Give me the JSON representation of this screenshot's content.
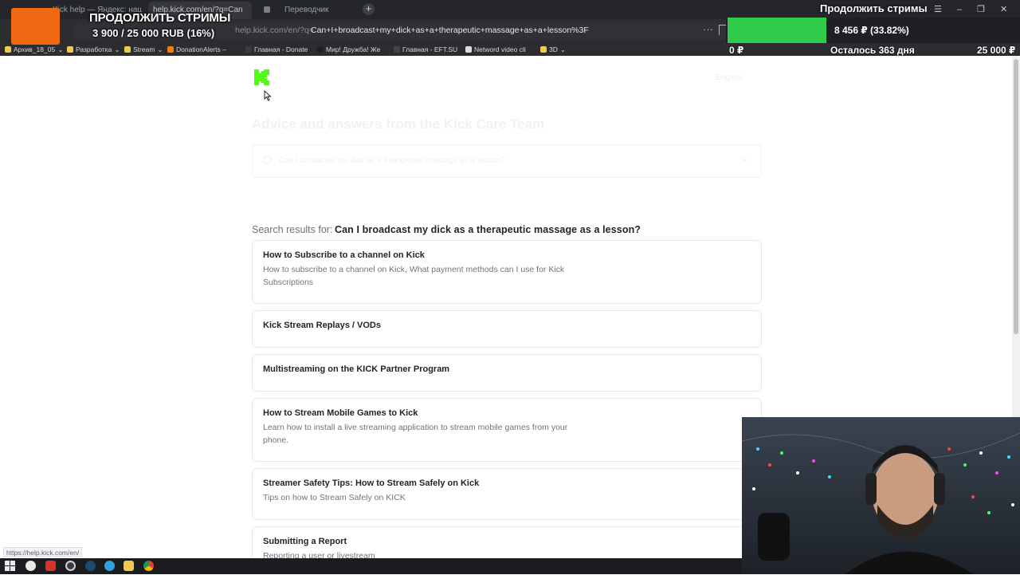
{
  "browser": {
    "tabs": [
      {
        "label": "Kick help — Яндекс: нашлось"
      },
      {
        "label": "help.kick.com/en/?q=Can"
      },
      {
        "label": "Переводчик"
      }
    ],
    "url_host": "help.kick.com/en/?q=",
    "url_query": "Can+I+broadcast+my+dick+as+a+therapeutic+massage+as+a+lesson%3F",
    "url_more": "···",
    "new_tab": "+",
    "window_controls": "☰ – ❐ ✕",
    "bookmarks": [
      {
        "label": "Архив_18_05",
        "icon_color": "#f2c94c",
        "chevron": "⌄"
      },
      {
        "label": "Разработка",
        "icon_color": "#f2c94c",
        "chevron": "⌄"
      },
      {
        "label": "Stream",
        "icon_color": "#f2c94c",
        "chevron": "⌄"
      },
      {
        "label": "DonationAlerts –",
        "icon_color": "#f57d07"
      },
      {
        "label": "Главная - Donate",
        "icon_color": "#3b3b3b"
      },
      {
        "label": "Мир! Дружба! Же",
        "icon_color": "#222222"
      },
      {
        "label": "Главная - EFT.SU",
        "icon_color": "#444444"
      },
      {
        "label": "Netword video cli",
        "icon_color": "#dddddd"
      },
      {
        "label": "3D",
        "icon_color": "#f2c94c",
        "chevron": "⌄"
      }
    ],
    "status_url": "https://help.kick.com/en/"
  },
  "overlay": {
    "left_title": "ПРОДОЛЖИТЬ СТРИМЫ",
    "left_amount": "3 900 / 25 000 RUB (16%)",
    "left_progress_fraction": 0.16,
    "right_title": "Продолжить стримы",
    "goal_amount": "8 456 ₽ (33.82%)",
    "goal_progress_fraction": 0.3382,
    "goal_min": "0 ₽",
    "goal_remaining": "Осталось 363 дня",
    "goal_max": "25 000 ₽",
    "colors": {
      "left_square": "#ef6a12",
      "goal_fill": "#2ecc4a"
    }
  },
  "page": {
    "brand_color": "#53fc18",
    "heading": "Advice and answers from the Kick Care Team",
    "language": "English",
    "search_placeholder": "Can I broadcast my dick as a therapeutic massage as a lesson?",
    "results_label": "Search results for:",
    "results_query": "Can I broadcast my dick as a therapeutic massage as a lesson?",
    "results": [
      {
        "title": "How to Subscribe to a channel on Kick",
        "desc": "How to subscribe to a channel on Kick, What payment methods can I use for Kick Subscriptions"
      },
      {
        "title": "Kick Stream Replays / VODs",
        "desc": ""
      },
      {
        "title": "Multistreaming on the KICK Partner Program",
        "desc": ""
      },
      {
        "title": "How to Stream Mobile Games to Kick",
        "desc": "Learn how to install a live streaming application to stream mobile games from your phone."
      },
      {
        "title": "Streamer Safety Tips: How to Stream Safely on Kick",
        "desc": "Tips on how to Stream Safely on KICK"
      },
      {
        "title": "Submitting a Report",
        "desc": "Reporting a user or livestream"
      }
    ]
  },
  "taskbar": {
    "icons": [
      "windows-start-icon",
      "yandex-browser-icon",
      "red-app-icon",
      "obs-icon",
      "steam-icon",
      "telegram-icon",
      "file-explorer-icon",
      "chrome-icon"
    ]
  }
}
